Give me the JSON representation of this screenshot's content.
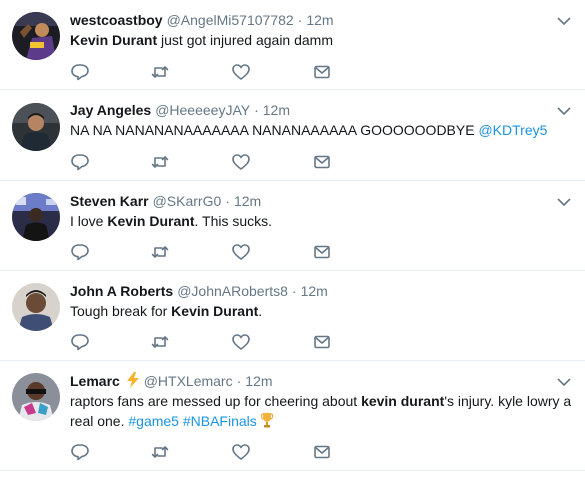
{
  "tweets": [
    {
      "name": "westcoastboy",
      "handle": "@AngelMi57107782",
      "time": "12m",
      "text_parts": {
        "bold1": "Kevin Durant",
        "rest1": " just got injured again damm"
      }
    },
    {
      "name": "Jay Angeles",
      "handle": "@HeeeeeyJAY",
      "time": "12m",
      "text_parts": {
        "rest1": "NA NA NANANANAAAAAAA NANANAAAAAA GOOOOOODBYE ",
        "mention": "@KDTrey5"
      }
    },
    {
      "name": "Steven Karr",
      "handle": "@SKarrG0",
      "time": "12m",
      "text_parts": {
        "rest1": "I love ",
        "bold1": "Kevin Durant",
        "rest2": ". This sucks."
      }
    },
    {
      "name": "John A Roberts",
      "handle": "@JohnARoberts8",
      "time": "12m",
      "text_parts": {
        "rest1": "Tough break for ",
        "bold1": "Kevin Durant",
        "rest2": "."
      }
    },
    {
      "name": "Lemarc",
      "handle": "@HTXLemarc",
      "time": "12m",
      "name_emoji": "⚡",
      "text_parts": {
        "rest1": "raptors fans are messed up for cheering about ",
        "bold1": "kevin durant",
        "rest2": "'s injury. kyle lowry a real one. ",
        "hashtag1": "#game5",
        "sep": " ",
        "hashtag2": "#NBAFinals",
        "trophy": "🏆"
      }
    }
  ],
  "separator": "·",
  "colors": {
    "link": "#1b95e0",
    "meta": "#657786",
    "icon": "#657786",
    "border": "#e6ecf0"
  }
}
